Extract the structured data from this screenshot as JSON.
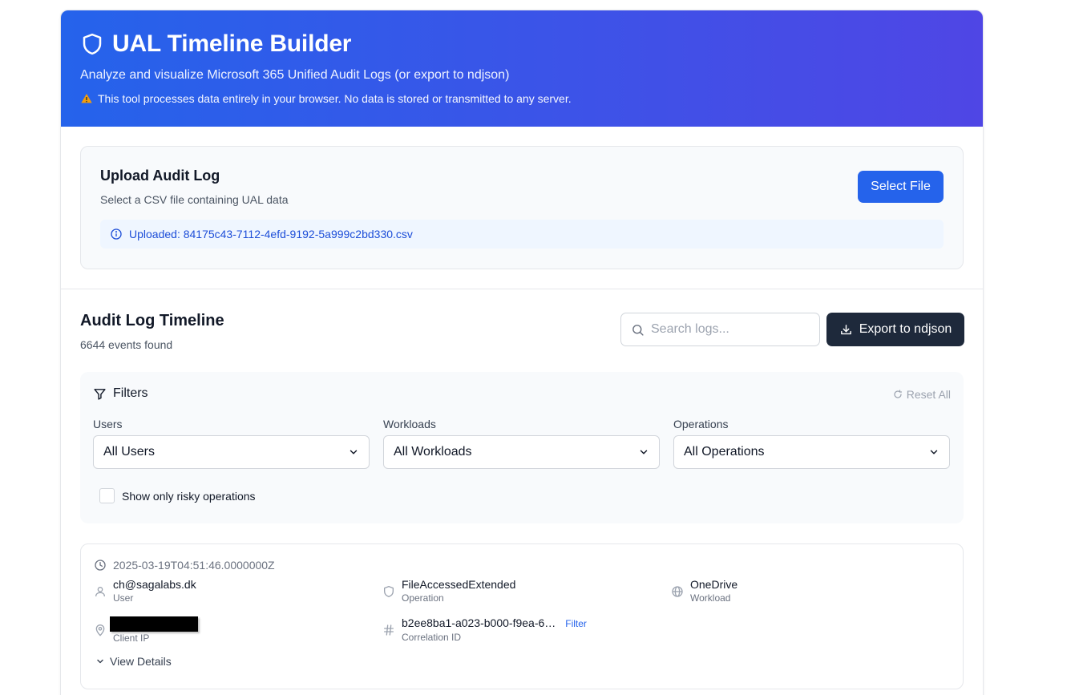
{
  "header": {
    "title": "UAL Timeline Builder",
    "subtitle": "Analyze and visualize Microsoft 365 Unified Audit Logs (or export to ndjson)",
    "notice": "This tool processes data entirely in your browser. No data is stored or transmitted to any server.",
    "icon": "shield-icon"
  },
  "upload": {
    "title": "Upload Audit Log",
    "description": "Select a CSV file containing UAL data",
    "button_label": "Select File",
    "uploaded_text": "Uploaded: 84175c43-7112-4efd-9192-5a999c2bd330.csv"
  },
  "timeline": {
    "title": "Audit Log Timeline",
    "count_text": "6644 events found",
    "search_placeholder": "Search logs...",
    "export_label": "Export to ndjson"
  },
  "filters": {
    "title": "Filters",
    "reset_label": "Reset All",
    "users": {
      "label": "Users",
      "selected": "All Users"
    },
    "workloads": {
      "label": "Workloads",
      "selected": "All Workloads"
    },
    "operations": {
      "label": "Operations",
      "selected": "All Operations"
    },
    "risky_label": "Show only risky operations"
  },
  "event": {
    "timestamp": "2025-03-19T04:51:46.0000000Z",
    "user": {
      "value": "ch@sagalabs.dk",
      "label": "User"
    },
    "operation": {
      "value": "FileAccessedExtended",
      "label": "Operation"
    },
    "workload": {
      "value": "OneDrive",
      "label": "Workload"
    },
    "client_ip": {
      "value": "",
      "label": "Client IP"
    },
    "correlation": {
      "value": "b2ee8ba1-a023-b000-f9ea-6…",
      "label": "Correlation ID",
      "filter_label": "Filter"
    },
    "view_details": "View Details"
  },
  "colors": {
    "header_gradient_start": "#2563eb",
    "header_gradient_end": "#4f46e5",
    "primary": "#2563eb",
    "dark_button": "#1e293b"
  }
}
